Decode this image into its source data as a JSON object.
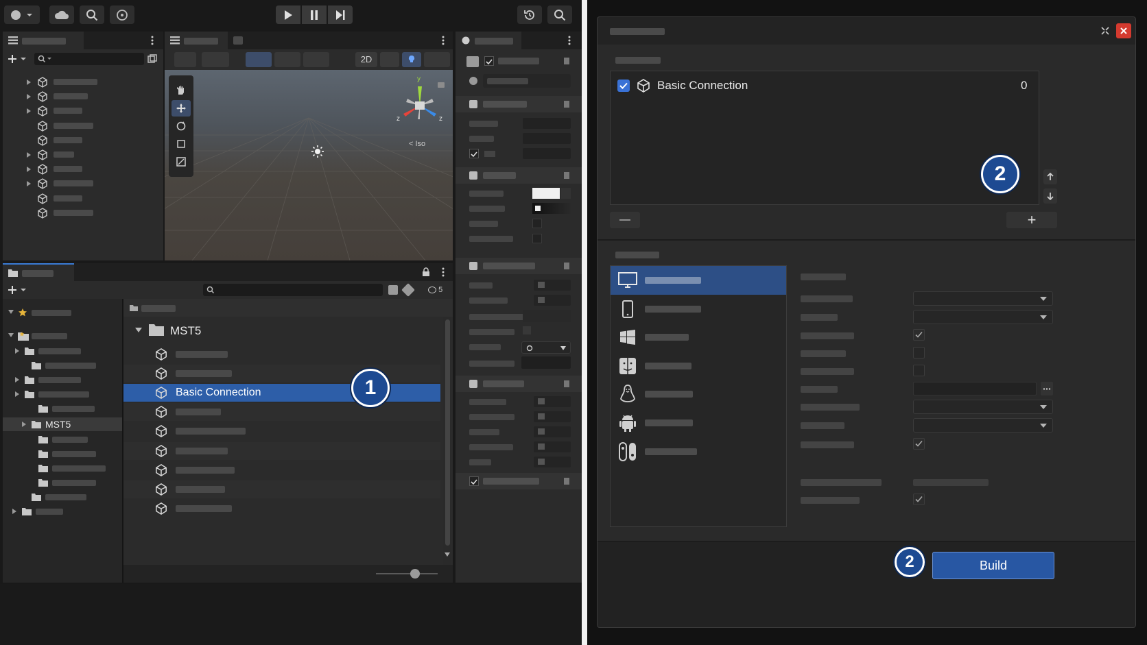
{
  "scene_view": {
    "mode_2d_label": "2D",
    "persp_label": "< Iso"
  },
  "gizmo": {
    "y_label": "y",
    "x_label": "z",
    "z_label": "z"
  },
  "project": {
    "search_count": "5",
    "folder_name": "MST5",
    "tree_selected": "MST5",
    "selected_asset": "Basic Connection"
  },
  "build_dialog": {
    "scene_entry_name": "Basic Connection",
    "scene_entry_index": "0",
    "remove_label": "—",
    "add_label": "+",
    "build_label": "Build"
  },
  "callouts": {
    "step1": "1",
    "step2a": "2",
    "step2b": "2"
  },
  "colors": {
    "selection": "#2d5ea8",
    "badge": "#1d4a92",
    "build_button": "#2857a3"
  },
  "icons": {
    "unity_asset": "unity-logo-icon",
    "folder": "folder-icon",
    "gameobject": "cube-icon",
    "platforms": [
      "monitor-icon",
      "phone-icon",
      "windows-icon",
      "finder-icon",
      "linux-icon",
      "android-icon",
      "switch-icon"
    ]
  }
}
